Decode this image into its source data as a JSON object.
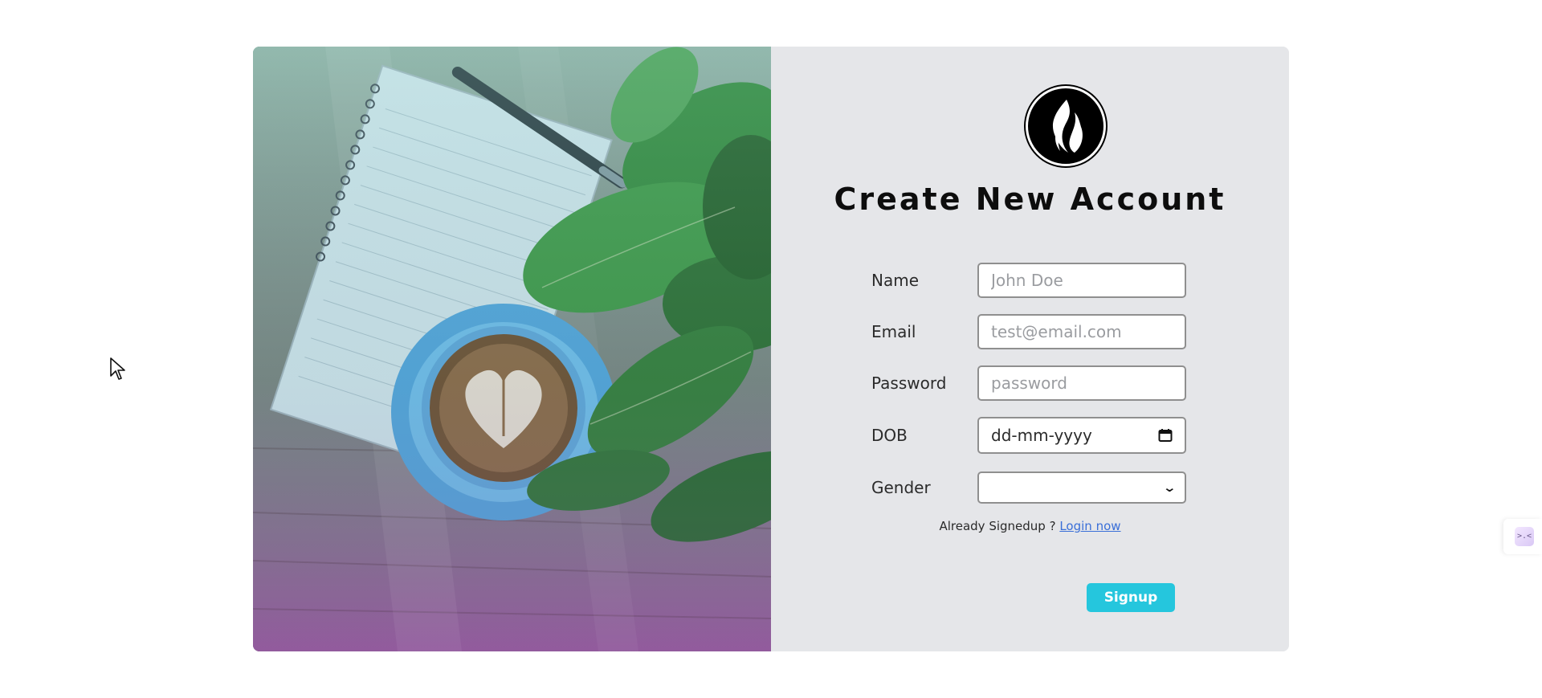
{
  "form": {
    "title": "Create New Account",
    "fields": [
      {
        "label": "Name",
        "placeholder": "John Doe",
        "type": "text"
      },
      {
        "label": "Email",
        "placeholder": "test@email.com",
        "type": "email"
      },
      {
        "label": "Password",
        "placeholder": "password",
        "type": "password"
      },
      {
        "label": "DOB",
        "placeholder": "dd-mm-yyyy",
        "type": "date"
      },
      {
        "label": "Gender",
        "value": "",
        "type": "select"
      }
    ],
    "already_text": "Already Signedup ? ",
    "login_link": "Login now",
    "submit_label": "Signup"
  },
  "icons": {
    "brand": "flame-logo-icon",
    "calendar": "calendar-icon",
    "select_arrow": "chevron-down-icon",
    "cursor": "mouse-pointer-icon",
    "widget": "extension-widget-icon"
  },
  "colors": {
    "panel_bg": "#e5e6e9",
    "button_bg": "#25c6dd",
    "link": "#3a6fd8",
    "brand_bg": "#000000"
  },
  "widget_text": ">.<"
}
